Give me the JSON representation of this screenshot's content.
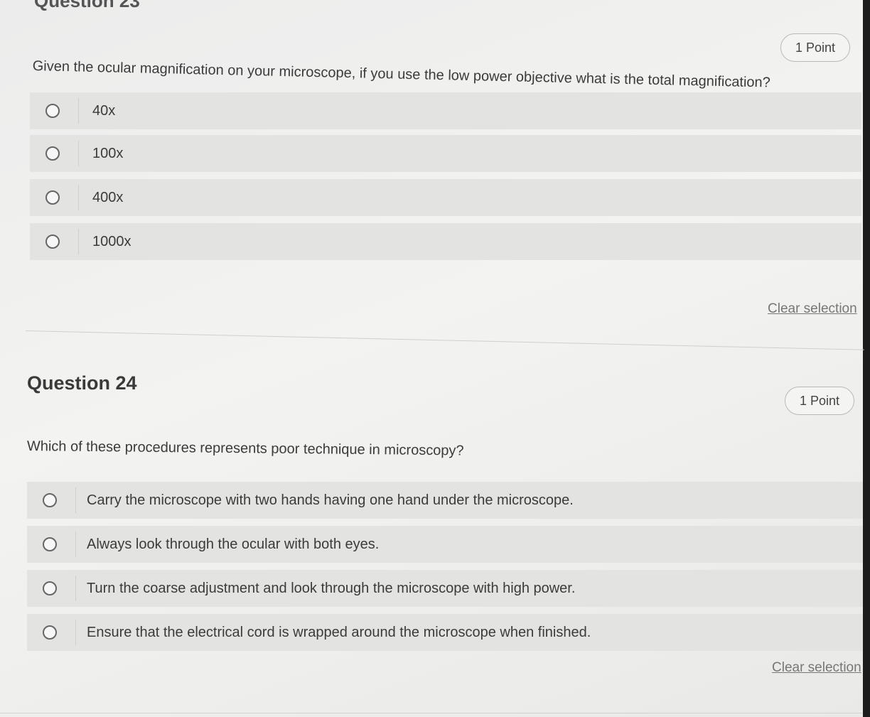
{
  "q23": {
    "title_partial": "Question 23",
    "points": "1 Point",
    "prompt": "Given the ocular magnification on your microscope, if you use the low power objective what is the total magnification?",
    "options": [
      "40x",
      "100x",
      "400x",
      "1000x"
    ],
    "clear_label": "Clear selection"
  },
  "q24": {
    "title": "Question 24",
    "points": "1 Point",
    "prompt": "Which of these procedures represents poor technique in microscopy?",
    "options": [
      "Carry the microscope with two hands having one hand under the microscope.",
      "Always look through the ocular with both eyes.",
      "Turn the coarse adjustment and look through the microscope with high power.",
      "Ensure that the electrical cord is wrapped around the microscope when finished."
    ],
    "clear_label": "Clear selection"
  }
}
